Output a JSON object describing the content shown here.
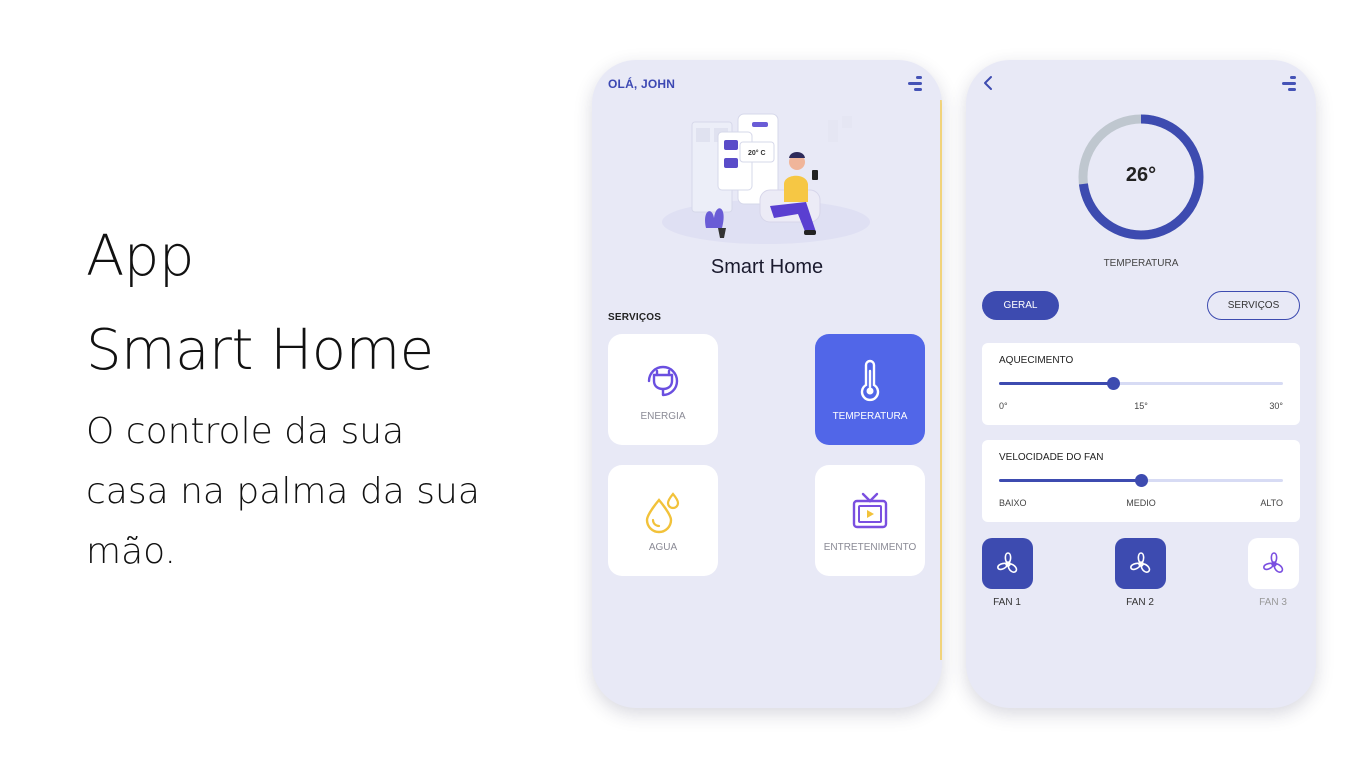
{
  "hero": {
    "line1": "App",
    "line2": "Smart Home",
    "subtitle": "O controle da sua casa na palma da sua mão."
  },
  "home_screen": {
    "greeting": "OLÁ, JOHN",
    "menu_icon": "menu-icon",
    "illustration_text": "20° C",
    "title": "Smart Home",
    "section_label": "SERVIÇOS",
    "tiles": [
      {
        "label": "ENERGIA",
        "icon": "plug-icon",
        "active": false
      },
      {
        "label": "TEMPERATURA",
        "icon": "thermometer-icon",
        "active": true
      },
      {
        "label": "AGUA",
        "icon": "water-drop-icon",
        "active": false
      },
      {
        "label": "ENTRETENIMENTO",
        "icon": "tv-icon",
        "active": false
      }
    ]
  },
  "temperature_screen": {
    "back_icon": "chevron-left-icon",
    "gauge_value": "26°",
    "gauge_fraction": 0.73,
    "gauge_label": "TEMPERATURA",
    "tabs": {
      "geral": "GERAL",
      "servicos": "SERVIÇOS"
    },
    "heating": {
      "title": "AQUECIMENTO",
      "min": "0°",
      "mid": "15°",
      "max": "30°",
      "fraction": 0.4
    },
    "fan_speed": {
      "title": "VELOCIDADE DO FAN",
      "min": "BAIXO",
      "mid": "MEDIO",
      "max": "ALTO",
      "fraction": 0.5
    },
    "fans": [
      {
        "label": "FAN 1",
        "on": true
      },
      {
        "label": "FAN 2",
        "on": true
      },
      {
        "label": "FAN 3",
        "on": false
      }
    ]
  },
  "colors": {
    "primary": "#3d4bb0",
    "tile_active": "#5166e8",
    "background": "#e8e9f6",
    "energy": "#6a4fe0",
    "water": "#f2c23a",
    "tv": "#7a4fe0"
  }
}
